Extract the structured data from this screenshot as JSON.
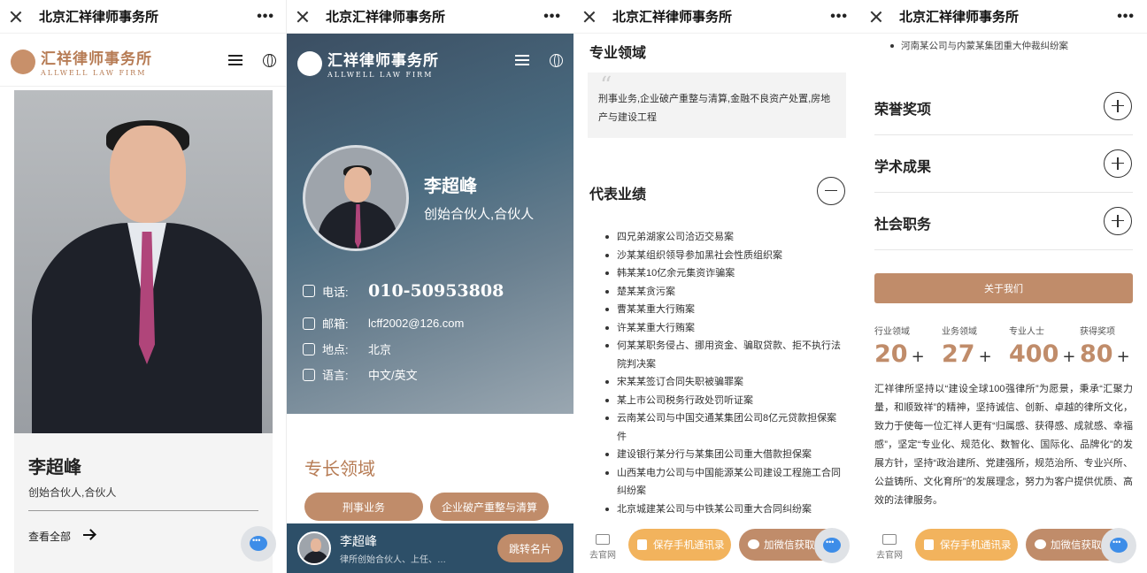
{
  "wechat": {
    "title": "北京汇祥律师事务所",
    "more": "•••"
  },
  "logo": {
    "cn": "汇祥律师事务所",
    "en": "ALLWELL LAW FIRM"
  },
  "lawyer": {
    "name": "李超峰",
    "role": "创始合伙人,合伙人",
    "view_all": "查看全部"
  },
  "contacts": [
    {
      "label": "电话:",
      "value": "010-50953808",
      "icon": "phone-icon"
    },
    {
      "label": "邮箱:",
      "value": "lcff2002@126.com",
      "icon": "mail-icon"
    },
    {
      "label": "地点:",
      "value": "北京",
      "icon": "location-icon"
    },
    {
      "label": "语言:",
      "value": "中文/英文",
      "icon": "language-icon"
    }
  ],
  "specialty": {
    "title": "专长领域",
    "pills": [
      "刑事业务",
      "企业破产重整与清算"
    ]
  },
  "bottom_card": {
    "name": "李超峰",
    "sub": "律所创始合伙人、上任、…",
    "button": "跳转名片"
  },
  "expertise": {
    "title": "专业领域",
    "text": "刑事业务,企业破产重整与清算,金融不良资产处置,房地产与建设工程"
  },
  "cases": {
    "title": "代表业绩",
    "items": [
      "四兄弟湖家公司洽迈交易案",
      "沙某某组织领导参加黑社会性质组织案",
      "韩某某10亿余元集资诈骗案",
      "楚某某贪污案",
      "曹某某重大行贿案",
      "许某某重大行贿案",
      "何某某职务侵占、挪用资金、骗取贷款、拒不执行法院判决案",
      "宋某某签订合同失职被骗罪案",
      "某上市公司税务行政处罚听证案",
      "云南某公司与中国交通某集团公司8亿元贷款担保案件",
      "建设银行某分行与某集团公司重大借款担保案",
      "山西某电力公司与中国能源某公司建设工程施工合同纠纷案",
      "北京城建某公司与中铁某公司重大合同纠纷案"
    ]
  },
  "footer": {
    "site": "去官网",
    "save": "保存手机通讯录",
    "wechat": "加微信获取名片"
  },
  "panel4": {
    "top_item": "河南某公司与内蒙某集团重大仲裁纠纷案",
    "accordions": [
      "荣誉奖项",
      "学术成果",
      "社会职务"
    ],
    "about_button": "关于我们",
    "stats": [
      {
        "label": "行业领域",
        "value": "20",
        "suffix": "+"
      },
      {
        "label": "业务领域",
        "value": "27",
        "suffix": "+"
      },
      {
        "label": "专业人士",
        "value": "400",
        "suffix": "+"
      },
      {
        "label": "获得奖项",
        "value": "80",
        "suffix": "+"
      }
    ],
    "paragraph": "汇祥律所坚持以“建设全球100强律所”为愿景，秉承“汇聚力量，和顺致祥”的精神，坚持诚信、创新、卓越的律所文化，致力于使每一位汇祥人更有“归属感、获得感、成就感、幸福感”，坚定“专业化、规范化、数智化、国际化、品牌化”的发展方针，坚持“政治建所、党建强所，规范治所、专业兴所、公益铸所、文化育所”的发展理念，努力为客户提供优质、高效的法律服务。"
  },
  "colors": {
    "accent": "#c08c6a",
    "dark_blue": "#2d4f68",
    "save_orange": "#f2b35d"
  }
}
